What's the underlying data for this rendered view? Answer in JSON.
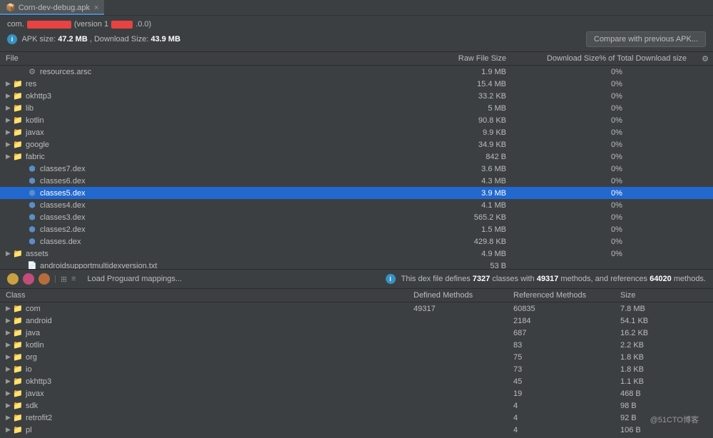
{
  "tab": {
    "title": "Corn-dev-debug.apk"
  },
  "header": {
    "package_prefix": "com.",
    "version_prefix": "(version 1",
    "version_suffix": ".0.0)",
    "size_line_prefix": "APK size: ",
    "apk_size": "47.2 MB",
    "download_prefix": ", Download Size: ",
    "download_size": "43.9 MB",
    "compare_btn": "Compare with previous APK..."
  },
  "columns": {
    "file": "File",
    "rawsize": "Raw File Size",
    "pct": "Download Size% of Total Download size"
  },
  "files": [
    {
      "expand": "",
      "indent": 20,
      "icon": "arsc",
      "name": "resources.arsc",
      "size": "1.9 MB",
      "pct": "0%",
      "sel": false
    },
    {
      "expand": "▶",
      "indent": 0,
      "icon": "folder",
      "name": "res",
      "size": "15.4 MB",
      "pct": "0%",
      "sel": false
    },
    {
      "expand": "▶",
      "indent": 0,
      "icon": "folder",
      "name": "okhttp3",
      "size": "33.2 KB",
      "pct": "0%",
      "sel": false
    },
    {
      "expand": "▶",
      "indent": 0,
      "icon": "folder",
      "name": "lib",
      "size": "5 MB",
      "pct": "0%",
      "sel": false
    },
    {
      "expand": "▶",
      "indent": 0,
      "icon": "folder",
      "name": "kotlin",
      "size": "90.8 KB",
      "pct": "0%",
      "sel": false
    },
    {
      "expand": "▶",
      "indent": 0,
      "icon": "folder",
      "name": "javax",
      "size": "9.9 KB",
      "pct": "0%",
      "sel": false
    },
    {
      "expand": "▶",
      "indent": 0,
      "icon": "folder",
      "name": "google",
      "size": "34.9 KB",
      "pct": "0%",
      "sel": false
    },
    {
      "expand": "▶",
      "indent": 0,
      "icon": "folder",
      "name": "fabric",
      "size": "842 B",
      "pct": "0%",
      "sel": false
    },
    {
      "expand": "",
      "indent": 20,
      "icon": "dex",
      "name": "classes7.dex",
      "size": "3.6 MB",
      "pct": "0%",
      "sel": false
    },
    {
      "expand": "",
      "indent": 20,
      "icon": "dex",
      "name": "classes6.dex",
      "size": "4.3 MB",
      "pct": "0%",
      "sel": false
    },
    {
      "expand": "",
      "indent": 20,
      "icon": "dex",
      "name": "classes5.dex",
      "size": "3.9 MB",
      "pct": "0%",
      "sel": true
    },
    {
      "expand": "",
      "indent": 20,
      "icon": "dex",
      "name": "classes4.dex",
      "size": "4.1 MB",
      "pct": "0%",
      "sel": false
    },
    {
      "expand": "",
      "indent": 20,
      "icon": "dex",
      "name": "classes3.dex",
      "size": "565.2 KB",
      "pct": "0%",
      "sel": false
    },
    {
      "expand": "",
      "indent": 20,
      "icon": "dex",
      "name": "classes2.dex",
      "size": "1.5 MB",
      "pct": "0%",
      "sel": false
    },
    {
      "expand": "",
      "indent": 20,
      "icon": "dex",
      "name": "classes.dex",
      "size": "429.8 KB",
      "pct": "0%",
      "sel": false
    },
    {
      "expand": "▶",
      "indent": 0,
      "icon": "folder",
      "name": "assets",
      "size": "4.9 MB",
      "pct": "0%",
      "sel": false
    },
    {
      "expand": "",
      "indent": 20,
      "icon": "txt",
      "name": "androidsupportmultidexversion.txt",
      "size": "53 B",
      "pct": "",
      "sel": false
    }
  ],
  "toolbar": {
    "load_proguard": "Load Proguard mappings...",
    "summary_prefix": "This dex file defines ",
    "classes_count": "7327",
    "summary_mid1": " classes with ",
    "methods_count": "49317",
    "summary_mid2": " methods, and references ",
    "refs_count": "64020",
    "summary_suffix": " methods."
  },
  "class_columns": {
    "class": "Class",
    "defined": "Defined Methods",
    "referenced": "Referenced Methods",
    "size": "Size"
  },
  "classes": [
    {
      "name": "com",
      "def": "49317",
      "ref": "60835",
      "size": "7.8 MB"
    },
    {
      "name": "android",
      "def": "",
      "ref": "2184",
      "size": "54.1 KB"
    },
    {
      "name": "java",
      "def": "",
      "ref": "687",
      "size": "16.2 KB"
    },
    {
      "name": "kotlin",
      "def": "",
      "ref": "83",
      "size": "2.2 KB"
    },
    {
      "name": "org",
      "def": "",
      "ref": "75",
      "size": "1.8 KB"
    },
    {
      "name": "io",
      "def": "",
      "ref": "73",
      "size": "1.8 KB"
    },
    {
      "name": "okhttp3",
      "def": "",
      "ref": "45",
      "size": "1.1 KB"
    },
    {
      "name": "javax",
      "def": "",
      "ref": "19",
      "size": "468 B"
    },
    {
      "name": "sdk",
      "def": "",
      "ref": "4",
      "size": "98 B"
    },
    {
      "name": "retrofit2",
      "def": "",
      "ref": "4",
      "size": "92 B"
    },
    {
      "name": "pl",
      "def": "",
      "ref": "4",
      "size": "106 B"
    }
  ],
  "watermark": "@51CTO博客"
}
